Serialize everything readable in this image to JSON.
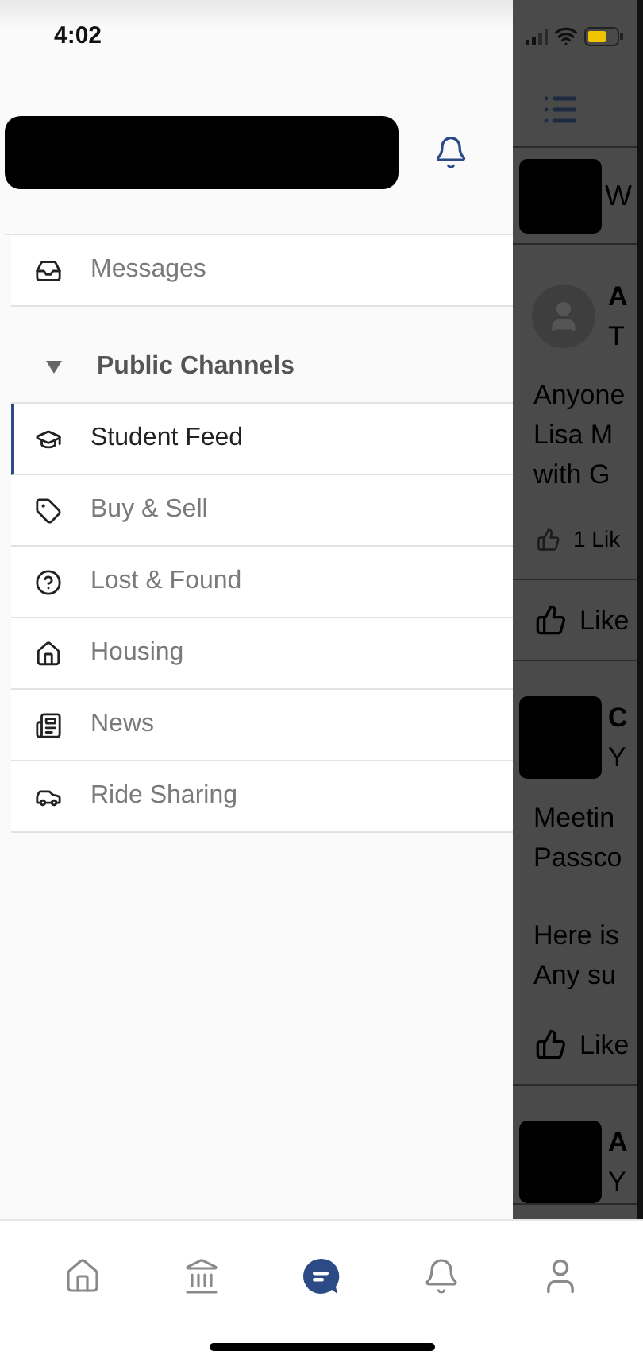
{
  "status_bar": {
    "time": "4:02"
  },
  "drawer": {
    "items": [
      {
        "label": "Messages",
        "selected": false
      }
    ],
    "section": {
      "label": "Public Channels",
      "expanded": true,
      "channels": [
        {
          "label": "Student Feed",
          "selected": true
        },
        {
          "label": "Buy & Sell",
          "selected": false
        },
        {
          "label": "Lost & Found",
          "selected": false
        },
        {
          "label": "Housing",
          "selected": false
        },
        {
          "label": "News",
          "selected": false
        },
        {
          "label": "Ride Sharing",
          "selected": false
        }
      ]
    }
  },
  "feed": {
    "header_text": "W",
    "posts": [
      {
        "kind": "placeholder",
        "author": "A",
        "subtitle": "T",
        "paragraphs": [
          [
            "Anyone",
            "Lisa M",
            "with G"
          ]
        ],
        "likes": "1 Lik",
        "action": "Like"
      },
      {
        "kind": "redacted",
        "author": "C",
        "subtitle": "Y",
        "paragraphs": [
          [
            "Meetin",
            "Passco"
          ],
          [
            "Here is",
            "Any su"
          ]
        ],
        "action": "Like"
      },
      {
        "kind": "redacted",
        "author": "A",
        "subtitle": "Y"
      }
    ]
  },
  "tab_bar": {
    "tabs": [
      {
        "selected": false
      },
      {
        "selected": false
      },
      {
        "selected": true
      },
      {
        "selected": false
      },
      {
        "selected": false
      }
    ]
  }
}
